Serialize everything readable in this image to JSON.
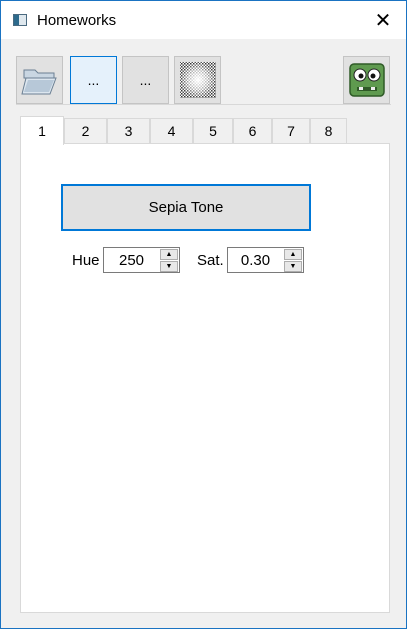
{
  "window": {
    "title": "Homeworks",
    "close_symbol": "✕"
  },
  "toolbar": {
    "buttons": [
      {
        "name": "open-folder",
        "icon": "folder-open-icon",
        "label": ""
      },
      {
        "name": "tool-1",
        "label": "..."
      },
      {
        "name": "tool-2",
        "label": "..."
      },
      {
        "name": "noise-texture",
        "icon": "noise-pattern-icon",
        "label": ""
      },
      {
        "name": "zombie",
        "icon": "zombie-face-icon",
        "label": ""
      }
    ]
  },
  "tabs": [
    "1",
    "2",
    "3",
    "4",
    "5",
    "6",
    "7",
    "8"
  ],
  "selected_tab": "1",
  "panel": {
    "action_button": "Sepia Tone",
    "hue": {
      "label": "Hue",
      "value": "250"
    },
    "saturation": {
      "label": "Sat.",
      "value": "0.30"
    }
  },
  "colors": {
    "accent": "#0078d7",
    "border": "#1a73c2"
  }
}
